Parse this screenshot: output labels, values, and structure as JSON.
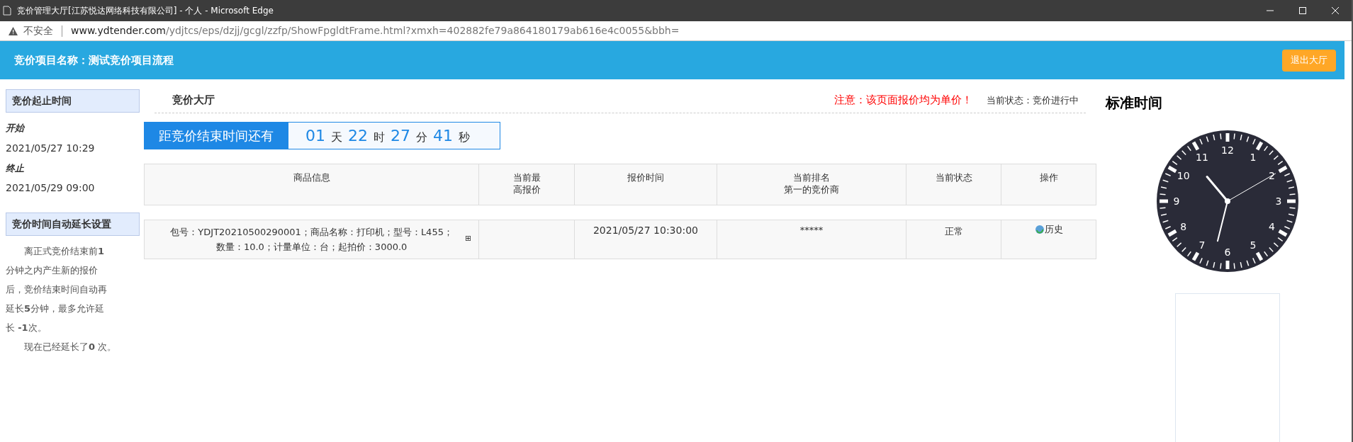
{
  "window": {
    "title": "竞价管理大厅[江苏悦达网络科技有限公司] - 个人 - Microsoft Edge"
  },
  "address_bar": {
    "security": "不安全",
    "url_host": "www.ydtender.com",
    "url_path": "/ydjtcs/eps/dzjj/gcgl/zzfp/ShowFpgldtFrame.html?xmxh=402882fe79a864180179ab616e4c0055&bbh="
  },
  "header": {
    "project": "竞价项目名称：测试竞价项目流程",
    "exit_button": "退出大厅"
  },
  "sidebar": {
    "time_title": "竞价起止时间",
    "start_label": "开始",
    "start": "2021/05/27 10:29",
    "end_label": "终止",
    "end": "2021/05/29 09:00",
    "extend_title": "竞价时间自动延长设置",
    "extend_rule": "离正式竞价结束前**1**分钟之内产生新的报价后，竞价结束时间自动再延长**5**分钟，最多允许延长 **-1**次。",
    "extend_count": "现在已经延长了**0** 次。"
  },
  "main": {
    "title": "竞价大厅",
    "notice": "注意：该页面报价均为单价！",
    "status": "当前状态：竞价进行中",
    "countdown": {
      "label": "距竞价结束时间还有",
      "parts": [
        {
          "value": "01",
          "unit": "天"
        },
        {
          "value": "22",
          "unit": "时"
        },
        {
          "value": "27",
          "unit": "分"
        },
        {
          "value": "41",
          "unit": "秒"
        }
      ]
    },
    "table": {
      "columns": [
        [
          "商品信息"
        ],
        [
          "当前最",
          "高报价"
        ],
        [
          "报价时间"
        ],
        [
          "当前排名",
          "第一的竞价商"
        ],
        [
          "当前状态"
        ],
        [
          "操作"
        ]
      ],
      "rows": [
        {
          "product": [
            "包号：YDJT20210500290001；商品名称：打印机；型号：L455；",
            "数量：10.0；计量单位：台；起拍价：3000.0"
          ],
          "expand": "⊞",
          "time": "2021/05/27 10:30:00",
          "leader": "*****",
          "state": "正常",
          "action": "历史"
        }
      ]
    }
  },
  "clock": {
    "title": "标准时间",
    "numerals": [
      "12",
      "1",
      "2",
      "3",
      "4",
      "5",
      "6",
      "7",
      "8",
      "9",
      "10",
      "11"
    ]
  }
}
